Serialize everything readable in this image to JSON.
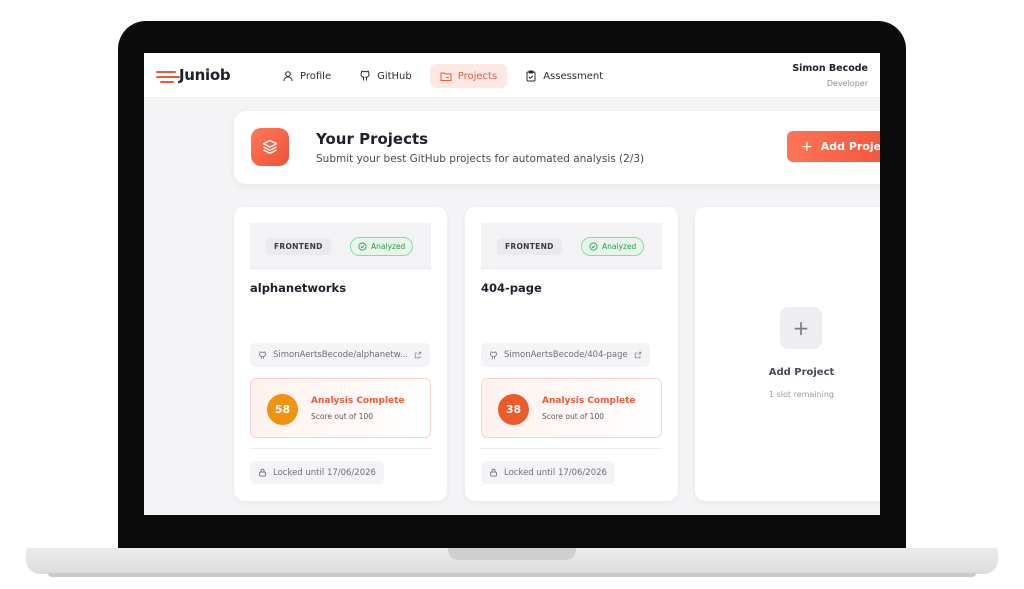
{
  "header": {
    "logo": "Juniob",
    "nav": [
      {
        "label": "Profile",
        "icon": "user-icon"
      },
      {
        "label": "GitHub",
        "icon": "github-icon"
      },
      {
        "label": "Projects",
        "icon": "projects-icon",
        "active": true
      },
      {
        "label": "Assessment",
        "icon": "clipboard-icon"
      }
    ],
    "user": {
      "name": "Simon Becode",
      "role": "Developer"
    }
  },
  "banner": {
    "title": "Your Projects",
    "subtitle": "Submit your best GitHub projects for automated analysis (2/3)",
    "add_button": "Add Project"
  },
  "projects": [
    {
      "category": "FRONTEND",
      "status": "Analyzed",
      "name": "alphanetworks",
      "repo": "SimonAertsBecode/alphanetw...",
      "score": "58",
      "score_color": "#f0930e",
      "result_title": "Analysis Complete",
      "result_sub": "Score out of 100",
      "locked": "Locked until 17/06/2026"
    },
    {
      "category": "FRONTEND",
      "status": "Analyzed",
      "name": "404-page",
      "repo": "SimonAertsBecode/404-page",
      "score": "38",
      "score_color": "#ee5a2a",
      "result_title": "Analysis Complete",
      "result_sub": "Score out of 100",
      "locked": "Locked until 17/06/2026"
    }
  ],
  "add_card": {
    "title": "Add Project",
    "subtitle": "1 slot remaining"
  },
  "colors": {
    "accent": "#ef5a3a",
    "success": "#2c9a4c"
  }
}
